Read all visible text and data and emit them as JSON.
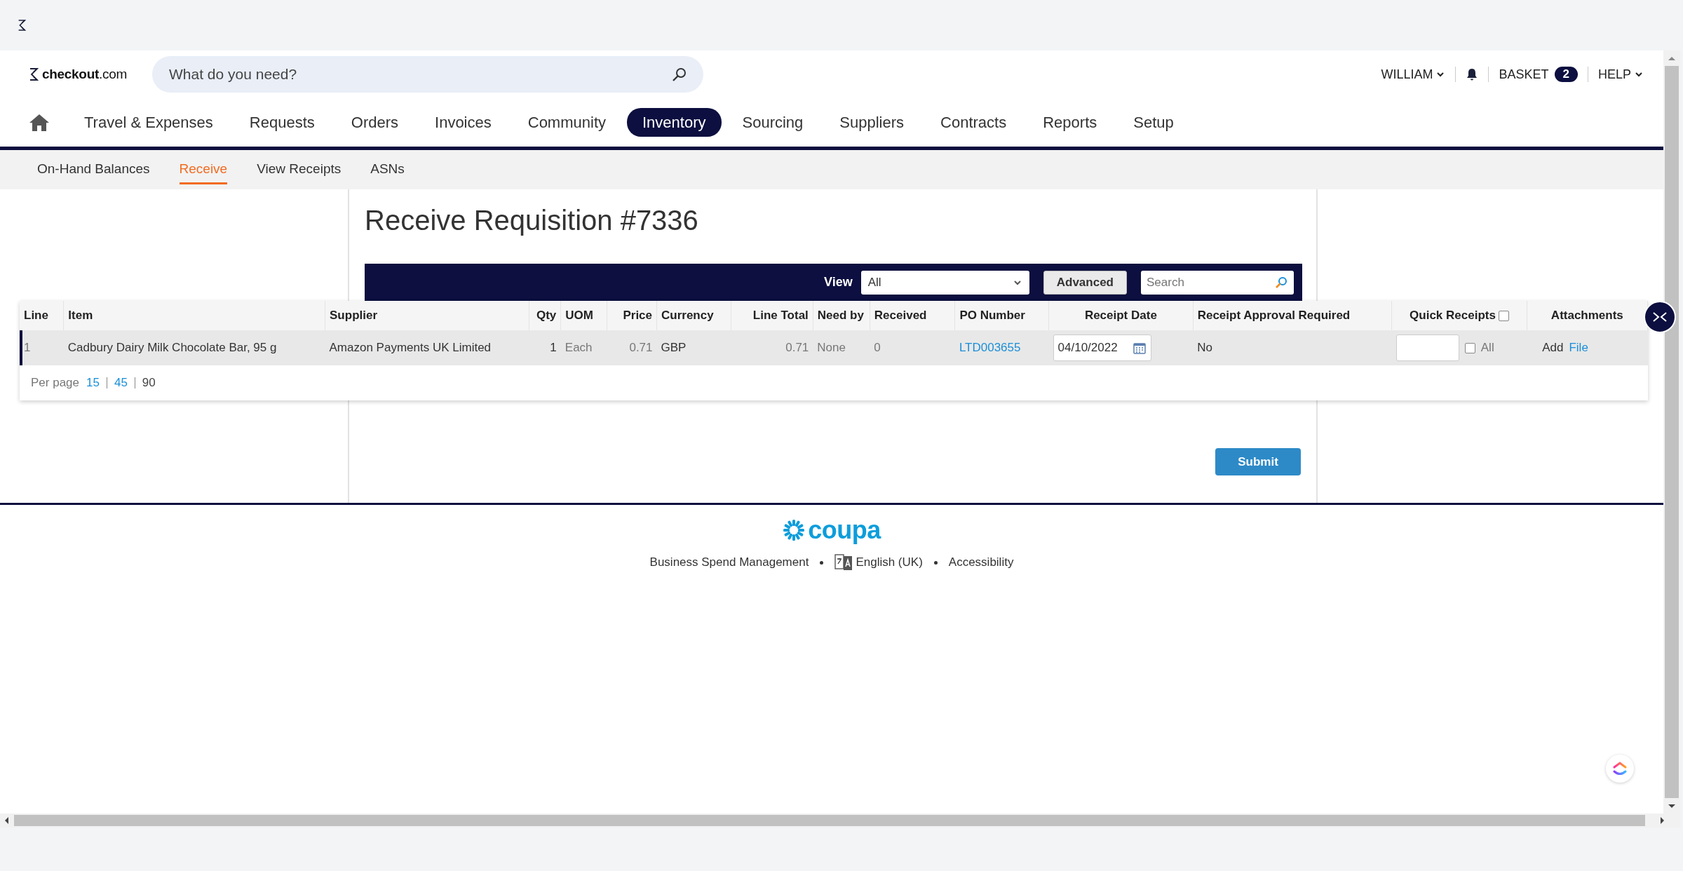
{
  "header": {
    "logo": "**checkout**.com",
    "search": {
      "placeholder": "What do you need?"
    },
    "user_menu": [
      {
        "kind": "dropdown",
        "label": "WILLIAM"
      },
      {
        "kind": "bell"
      },
      {
        "kind": "basket",
        "label": "BASKET",
        "count": "2"
      },
      {
        "kind": "dropdown",
        "label": "HELP"
      }
    ]
  },
  "nav": [
    {
      "label": "Travel & Expenses",
      "selected": false
    },
    {
      "label": "Requests",
      "selected": false
    },
    {
      "label": "Orders",
      "selected": false
    },
    {
      "label": "Invoices",
      "selected": false
    },
    {
      "label": "Community",
      "selected": false
    },
    {
      "label": "Inventory",
      "selected": true
    },
    {
      "label": "Sourcing",
      "selected": false
    },
    {
      "label": "Suppliers",
      "selected": false
    },
    {
      "label": "Contracts",
      "selected": false
    },
    {
      "label": "Reports",
      "selected": false
    },
    {
      "label": "Setup",
      "selected": false
    }
  ],
  "subnav": [
    {
      "label": "On-Hand Balances",
      "selected": false
    },
    {
      "label": "Receive",
      "selected": true
    },
    {
      "label": "View Receipts",
      "selected": false
    },
    {
      "label": "ASNs",
      "selected": false
    }
  ],
  "page": {
    "title": "Receive Requisition #7336"
  },
  "toolbar": {
    "view_label": "View",
    "view_value": "All",
    "advanced_button": "Advanced",
    "search": {
      "placeholder": "Search"
    }
  },
  "table": {
    "columns": [
      {
        "label": "Line"
      },
      {
        "label": "Item"
      },
      {
        "label": "Supplier"
      },
      {
        "label": "Qty"
      },
      {
        "label": "UOM"
      },
      {
        "label": "Price"
      },
      {
        "label": "Currency"
      },
      {
        "label": "Line Total"
      },
      {
        "label": "Need by"
      },
      {
        "label": "Received"
      },
      {
        "label": "PO Number"
      },
      {
        "label": "Receipt Date"
      },
      {
        "label": "Receipt Approval Required"
      },
      {
        "label": "Quick Receipts",
        "checked": false
      },
      {
        "label": "Attachments"
      }
    ],
    "rows": [
      {
        "selected": true,
        "cells": [
          {
            "kind": "muted",
            "text": "1"
          },
          {
            "kind": "text",
            "text": "Cadbury Dairy Milk Chocolate Bar, 95 g"
          },
          {
            "kind": "text",
            "text": "Amazon Payments UK Limited"
          },
          {
            "kind": "text",
            "text": "1"
          },
          {
            "kind": "muted",
            "text": "Each"
          },
          {
            "kind": "muted",
            "text": "0.71"
          },
          {
            "kind": "text",
            "text": "GBP"
          },
          {
            "kind": "muted",
            "text": "0.71"
          },
          {
            "kind": "muted",
            "text": "None"
          },
          {
            "kind": "muted",
            "text": "0"
          },
          {
            "kind": "link",
            "text": "LTD003655"
          },
          {
            "kind": "date",
            "text": "04/10/2022"
          },
          {
            "kind": "text",
            "text": "No"
          },
          {
            "kind": "quick_receipt",
            "all_label": "All",
            "all_checked": false
          },
          {
            "kind": "attachment",
            "text": "Add",
            "link": "File"
          }
        ]
      }
    ],
    "pagination": {
      "label": "Per page",
      "options": [
        {
          "label": "15",
          "selected": false
        },
        {
          "label": "45",
          "selected": false
        },
        {
          "label": "90",
          "selected": true
        }
      ]
    }
  },
  "submit_button": "Submit",
  "footer": {
    "brand": "coupa",
    "links": [
      {
        "kind": "text",
        "label": "Business Spend Management"
      },
      {
        "kind": "language",
        "label": "English (UK)"
      },
      {
        "kind": "text",
        "label": "Accessibility"
      }
    ]
  }
}
